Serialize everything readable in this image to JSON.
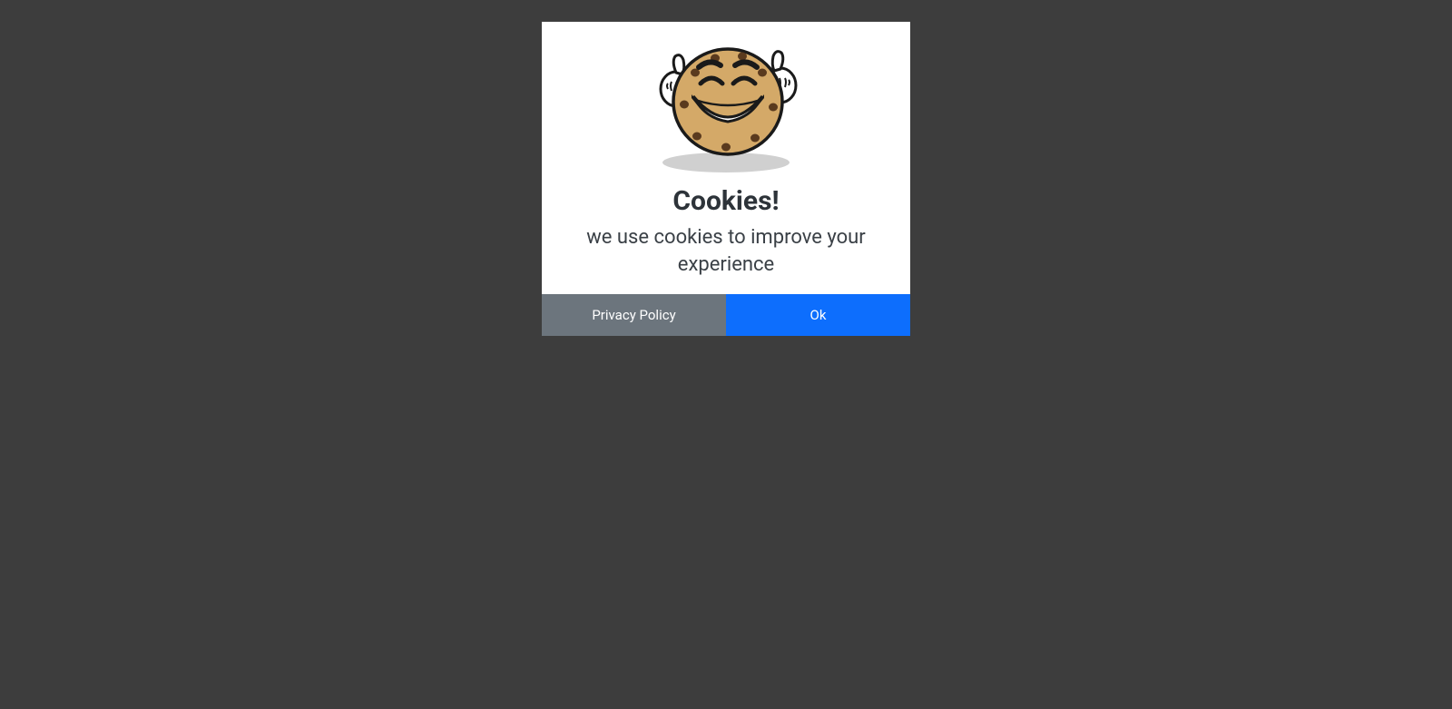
{
  "modal": {
    "title": "Cookies!",
    "description": "we use cookies to improve your experience",
    "buttons": {
      "secondary_label": "Privacy Policy",
      "primary_label": "Ok"
    }
  },
  "colors": {
    "background": "#3d3d3d",
    "modal_bg": "#ffffff",
    "title": "#2d3339",
    "description": "#3a4046",
    "btn_secondary": "#6c757d",
    "btn_primary": "#0d6efd"
  },
  "icon": {
    "name": "cookie-character-thumbs-up"
  }
}
